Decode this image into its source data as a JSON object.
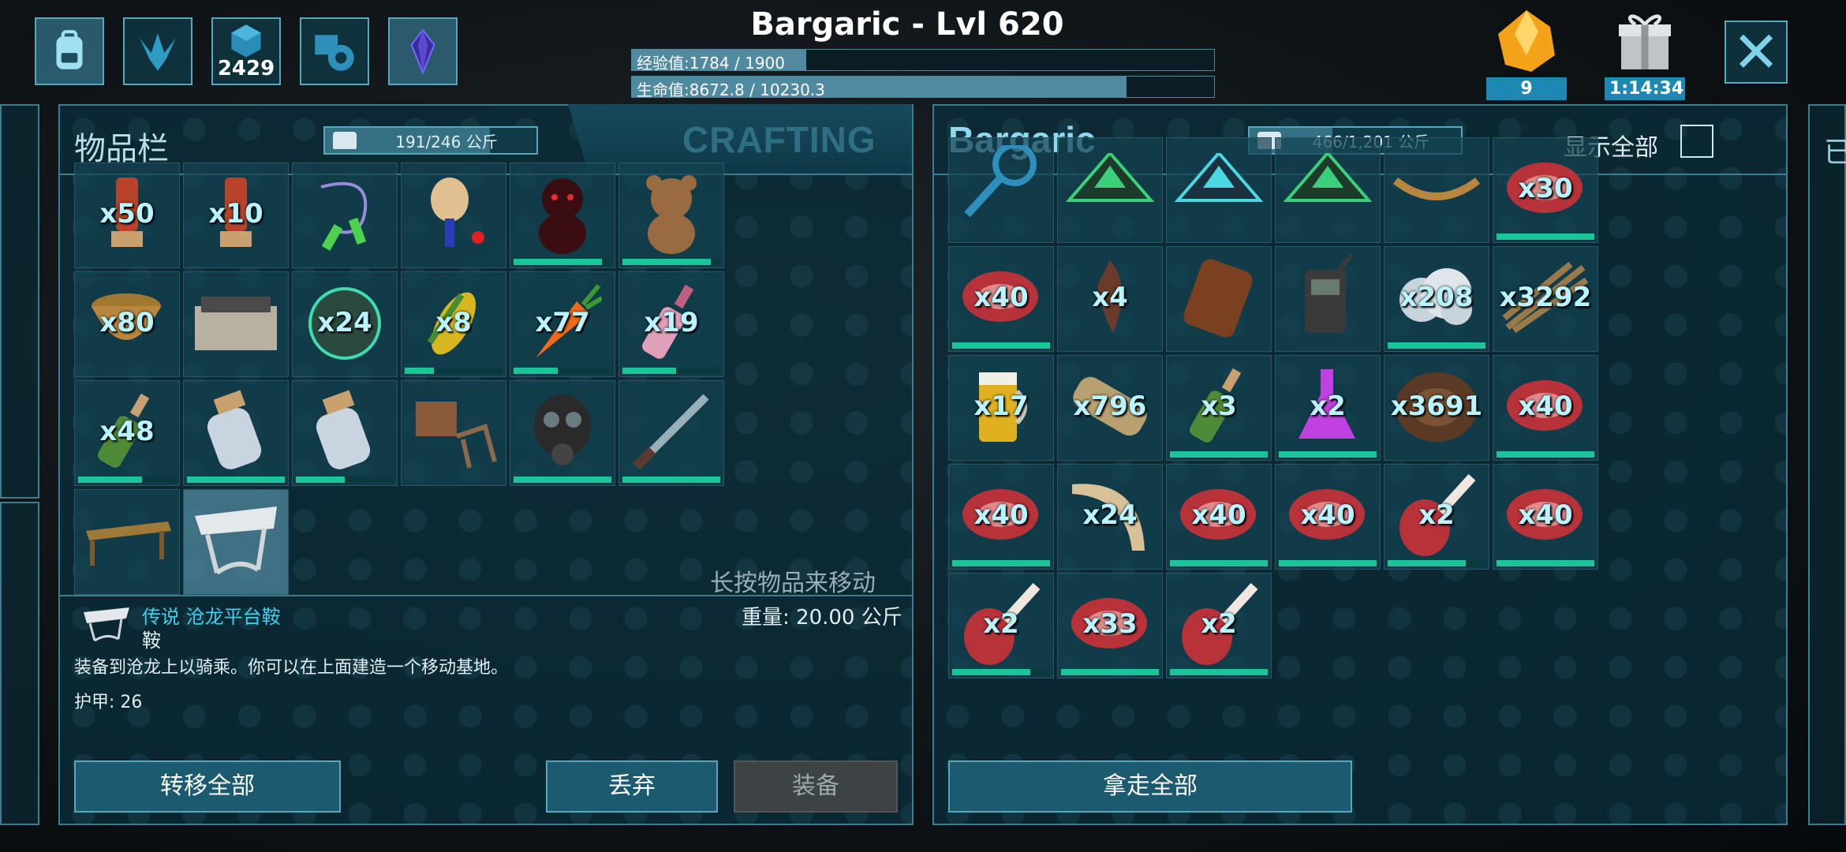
{
  "top_bar": {
    "icons": [
      {
        "name": "backpack-icon"
      },
      {
        "name": "dino-footprint-icon"
      },
      {
        "name": "engram-points-icon",
        "value": "2429"
      },
      {
        "name": "settings-gear-icon"
      },
      {
        "name": "crystal-icon"
      }
    ],
    "player_title": "Bargaric - Lvl 620",
    "xp": {
      "label": "经验值:1784 / 1900",
      "fraction": 0.3
    },
    "hp": {
      "label": "生命值:8672.8 / 10230.3",
      "fraction": 0.85
    },
    "amber": {
      "value": "9"
    },
    "gift_timer": {
      "value": "1:14:34"
    }
  },
  "left_panel": {
    "title": "物品栏",
    "weight": {
      "text": "191/246 公斤",
      "fraction": 0.78
    },
    "crafting_tab": "CRAFTING",
    "slots": [
      {
        "icon": "ammo-canister-icon",
        "qty": "x50"
      },
      {
        "icon": "ammo-canister-icon",
        "qty": "x10"
      },
      {
        "icon": "jump-rope-icon",
        "qty": ""
      },
      {
        "icon": "paddle-ball-icon",
        "qty": ""
      },
      {
        "icon": "dark-teddy-bear-icon",
        "qty": "",
        "durability": 0.9
      },
      {
        "icon": "teddy-bear-icon",
        "qty": "",
        "durability": 0.9
      },
      {
        "icon": "bowl-icon",
        "qty": "x80"
      },
      {
        "icon": "cooking-station-icon",
        "qty": ""
      },
      {
        "icon": "element-dust-icon",
        "qty": "x24"
      },
      {
        "icon": "corn-icon",
        "qty": "x8",
        "durability": 0.3
      },
      {
        "icon": "carrot-icon",
        "qty": "x77",
        "durability": 0.45
      },
      {
        "icon": "pink-bottle-icon",
        "qty": "x19",
        "durability": 0.55
      },
      {
        "icon": "green-bottle-icon",
        "qty": "x48",
        "durability": 0.65
      },
      {
        "icon": "water-jar-icon",
        "qty": "",
        "durability": 1.0
      },
      {
        "icon": "water-jar-icon",
        "qty": "",
        "durability": 0.5
      },
      {
        "icon": "easel-icon",
        "qty": ""
      },
      {
        "icon": "gas-mask-icon",
        "qty": "",
        "durability": 1.0
      },
      {
        "icon": "sword-icon",
        "qty": "",
        "durability": 1.0
      },
      {
        "icon": "table-icon",
        "qty": ""
      },
      {
        "icon": "platform-saddle-icon",
        "qty": "",
        "selected": true
      }
    ],
    "hint": "长按物品来移动",
    "item": {
      "name": "传说 沧龙平台鞍",
      "type": "鞍",
      "weight": "重量: 20.00 公斤",
      "description": "装备到沧龙上以骑乘。你可以在上面建造一个移动基地。",
      "armor": "护甲: 26"
    },
    "buttons": {
      "transfer_all": "转移全部",
      "drop": "丢弃",
      "equip": "装备"
    }
  },
  "right_panel": {
    "title": "Bargaric",
    "weight": {
      "text": "466/1,201 公斤",
      "fraction": 0.39
    },
    "show_all_label": "显示全部",
    "slots": [
      {
        "icon": "magnifier-icon",
        "qty": ""
      },
      {
        "icon": "green-crystal-icon",
        "qty": ""
      },
      {
        "icon": "blue-crystal-icon",
        "qty": ""
      },
      {
        "icon": "green-crystal-icon",
        "qty": ""
      },
      {
        "icon": "rope-icon",
        "qty": ""
      },
      {
        "icon": "raw-meat-icon",
        "qty": "x30",
        "durability": 1.0
      },
      {
        "icon": "raw-meat-icon",
        "qty": "x40",
        "durability": 1.0
      },
      {
        "icon": "tooth-icon",
        "qty": "x4"
      },
      {
        "icon": "leather-sack-icon",
        "qty": ""
      },
      {
        "icon": "radio-icon",
        "qty": ""
      },
      {
        "icon": "cloud-icon",
        "qty": "x208",
        "durability": 1.0
      },
      {
        "icon": "fiber-icon",
        "qty": "x3292"
      },
      {
        "icon": "beer-mug-icon",
        "qty": "x17"
      },
      {
        "icon": "wood-log-icon",
        "qty": "x796"
      },
      {
        "icon": "green-bottle-icon",
        "qty": "x3",
        "durability": 1.0
      },
      {
        "icon": "purple-flask-icon",
        "qty": "x2",
        "durability": 1.0
      },
      {
        "icon": "hide-icon",
        "qty": "x3691"
      },
      {
        "icon": "raw-meat-icon",
        "qty": "x40",
        "durability": 1.0
      },
      {
        "icon": "raw-meat-icon",
        "qty": "x40",
        "durability": 1.0
      },
      {
        "icon": "horn-icon",
        "qty": "x24"
      },
      {
        "icon": "raw-meat-icon",
        "qty": "x40",
        "durability": 1.0
      },
      {
        "icon": "raw-meat-icon",
        "qty": "x40",
        "durability": 1.0
      },
      {
        "icon": "drumstick-icon",
        "qty": "x2",
        "durability": 0.8
      },
      {
        "icon": "raw-meat-icon",
        "qty": "x40",
        "durability": 1.0
      },
      {
        "icon": "drumstick-icon",
        "qty": "x2",
        "durability": 0.8
      },
      {
        "icon": "raw-meat-icon",
        "qty": "x33",
        "durability": 1.0
      },
      {
        "icon": "drumstick-icon",
        "qty": "x2",
        "durability": 1.0
      }
    ],
    "buttons": {
      "take_all": "拿走全部"
    }
  },
  "colors": {
    "accent": "#5aa7bd",
    "durability": "#1bc59a",
    "qty_text": "#b8f4ff"
  }
}
